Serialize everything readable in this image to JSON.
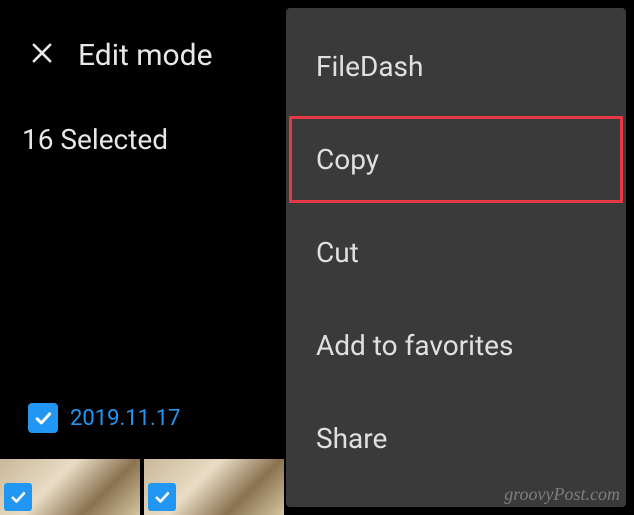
{
  "header": {
    "title": "Edit mode"
  },
  "selection": {
    "count_label": "16 Selected"
  },
  "date": {
    "label": "2019.11.17"
  },
  "menu": {
    "items": [
      {
        "label": "FileDash",
        "highlight": false
      },
      {
        "label": "Copy",
        "highlight": true
      },
      {
        "label": "Cut",
        "highlight": false
      },
      {
        "label": "Add to favorites",
        "highlight": false
      },
      {
        "label": "Share",
        "highlight": false
      }
    ]
  },
  "watermark": "groovyPost.com"
}
